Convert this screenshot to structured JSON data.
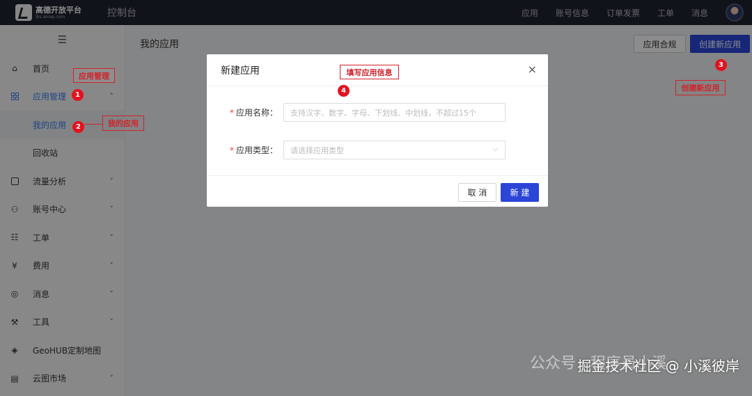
{
  "topbar": {
    "logo_name": "高德开放平台",
    "logo_url": "lbs.amap.com",
    "console_title": "控制台",
    "nav": [
      "应用",
      "账号信息",
      "订单发票",
      "工单",
      "消息"
    ]
  },
  "sidebar": {
    "toggle_icon": "hamburger-icon",
    "items": [
      {
        "label": "首页",
        "icon": "home-icon"
      },
      {
        "label": "应用管理",
        "icon": "grid-icon",
        "chevron": "˄"
      },
      {
        "label": "我的应用"
      },
      {
        "label": "回收站"
      },
      {
        "label": "流量分析",
        "icon": "chart-icon",
        "chevron": "˅"
      },
      {
        "label": "账号中心",
        "icon": "user-icon",
        "chevron": "˅"
      },
      {
        "label": "工单",
        "icon": "ticket-icon",
        "chevron": "˅"
      },
      {
        "label": "费用",
        "icon": "yen-icon",
        "chevron": "˅"
      },
      {
        "label": "消息",
        "icon": "message-icon",
        "chevron": "˅"
      },
      {
        "label": "工具",
        "icon": "wrench-icon",
        "chevron": "˅"
      },
      {
        "label": "GeoHUB定制地图",
        "icon": "layers-icon"
      },
      {
        "label": "云图市场",
        "icon": "store-icon",
        "chevron": "˅"
      }
    ]
  },
  "main": {
    "page_title": "我的应用",
    "compliance_button": "应用合规",
    "create_app_button": "创建新应用"
  },
  "modal": {
    "title": "新建应用",
    "close_icon": "×",
    "fields": [
      {
        "label": "应用名称：",
        "required_mark": "*",
        "placeholder": "支持汉字、数字、字母、下划线、中划线，不超过15个"
      },
      {
        "label": "应用类型：",
        "required_mark": "*",
        "placeholder": "请选择应用类型",
        "dropdown_icon": "⌵"
      }
    ],
    "cancel_button": "取 消",
    "create_button": "新 建"
  },
  "annotations": {
    "app_management": "应用管理",
    "my_apps": "我的应用",
    "fill_app_info": "填写应用信息",
    "create_new_app": "创建新应用",
    "badges": [
      "1",
      "2",
      "3",
      "4"
    ],
    "color": "#d0232a"
  },
  "watermark": {
    "ghost_text": "公众号 · 程序员小溪",
    "text": "掘金技术社区 @ 小溪彼岸"
  },
  "colors": {
    "topbar_bg": "#1f2430",
    "primary": "#2b45d9",
    "required": "#f0412c"
  }
}
